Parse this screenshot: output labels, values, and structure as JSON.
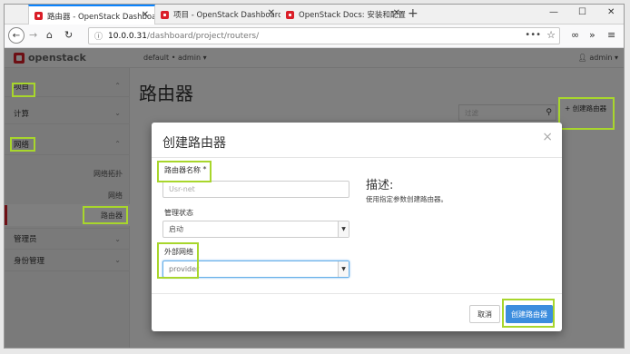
{
  "browser": {
    "tabs": [
      {
        "title": "路由器 - OpenStack Dashboa",
        "active": true
      },
      {
        "title": "项目 - OpenStack Dashboard",
        "active": false
      },
      {
        "title": "OpenStack Docs: 安装和配置",
        "active": false
      }
    ],
    "close_glyph": "✕",
    "new_tab_glyph": "+",
    "url_host": "10.0.0.31",
    "url_path": "/dashboard/project/routers/",
    "window_controls": [
      "—",
      "☐",
      "✕"
    ]
  },
  "header": {
    "logo_text": "openstack",
    "project_selector": "default • admin ▾",
    "user_menu": "admin ▾"
  },
  "sidebar": {
    "items": [
      {
        "label": "项目",
        "chevron": "⌃"
      },
      {
        "label": "计算",
        "chevron": "⌄"
      },
      {
        "label": "网络",
        "chevron": "⌃"
      },
      {
        "label": "网络拓扑"
      },
      {
        "label": "网络"
      },
      {
        "label": "路由器"
      },
      {
        "label": "管理员",
        "chevron": "⌄"
      },
      {
        "label": "身份管理",
        "chevron": "⌄"
      }
    ]
  },
  "main": {
    "title": "路由器",
    "filter_placeholder": "过滤",
    "create_button": "创建路由器"
  },
  "modal": {
    "title": "创建路由器",
    "close": "×",
    "name_label": "路由器名称",
    "required_mark": "*",
    "name_value": "Usr-net",
    "admin_state_label": "管理状态",
    "admin_state_value": "启动",
    "external_net_label": "外部网络",
    "external_net_value": "provider",
    "description_title": "描述:",
    "description_text": "使用指定参数创建路由器。",
    "cancel_button": "取消",
    "submit_button": "创建路由器"
  },
  "colors": {
    "accent": "#da1e28",
    "primary_button": "#3c8dde",
    "highlight_box": "#a8d62c"
  }
}
